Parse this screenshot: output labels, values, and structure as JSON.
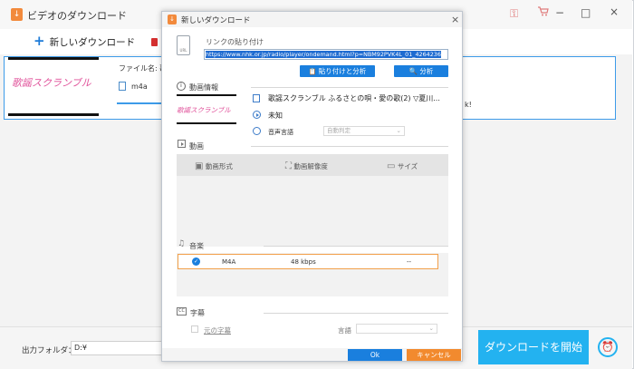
{
  "app": {
    "title": "ビデオのダウンロード",
    "minimize": "−",
    "maximize": "□",
    "close": "×",
    "key_icon": "⚿",
    "cart_icon": "🛒"
  },
  "toolbar": {
    "new_download": "新しいダウンロード"
  },
  "item": {
    "thumbnail_text": "歌謡スクランブル",
    "filename_label": "ファイル名: 歌謡",
    "format": "m4a",
    "right_note": "k!"
  },
  "bottom": {
    "output_label": "出力フォルダ：",
    "output_value": "D:¥",
    "download_button": "ダウンロードを開始"
  },
  "dialog": {
    "title": "新しいダウンロード",
    "close": "×",
    "paste_label": "リンクの貼り付け",
    "url": "https://www.nhk.or.jp/radio/player/ondemand.html?p=NBM92PVK4L_01_4264236",
    "paste_analyze_button": "貼り付けと分析",
    "analyze_button": "分析",
    "video_info_label": "動画情報",
    "media_title": "歌謡スクランブル ふるさとの唄・愛の歌(2) ▽夏川...",
    "duration": "未知",
    "audio_label": "音声言語",
    "audio_select": "自動判定",
    "video_section": "動画",
    "col_format": "動画形式",
    "col_resolution": "動画解像度",
    "col_size": "サイズ",
    "music_section": "音楽",
    "audio_row": {
      "format": "M4A",
      "bitrate": "48 kbps",
      "size": "--"
    },
    "subtitle_section": "字幕",
    "orig_subtitle": "元の字幕",
    "lang_label": "言語",
    "ok_button": "Ok",
    "cancel_button": "キャンセル"
  },
  "colors": {
    "accent_blue": "#1a7fde",
    "download_blue": "#23b2f0",
    "cancel_orange": "#f28a2e",
    "selected_row_border": "#f2a04a"
  }
}
